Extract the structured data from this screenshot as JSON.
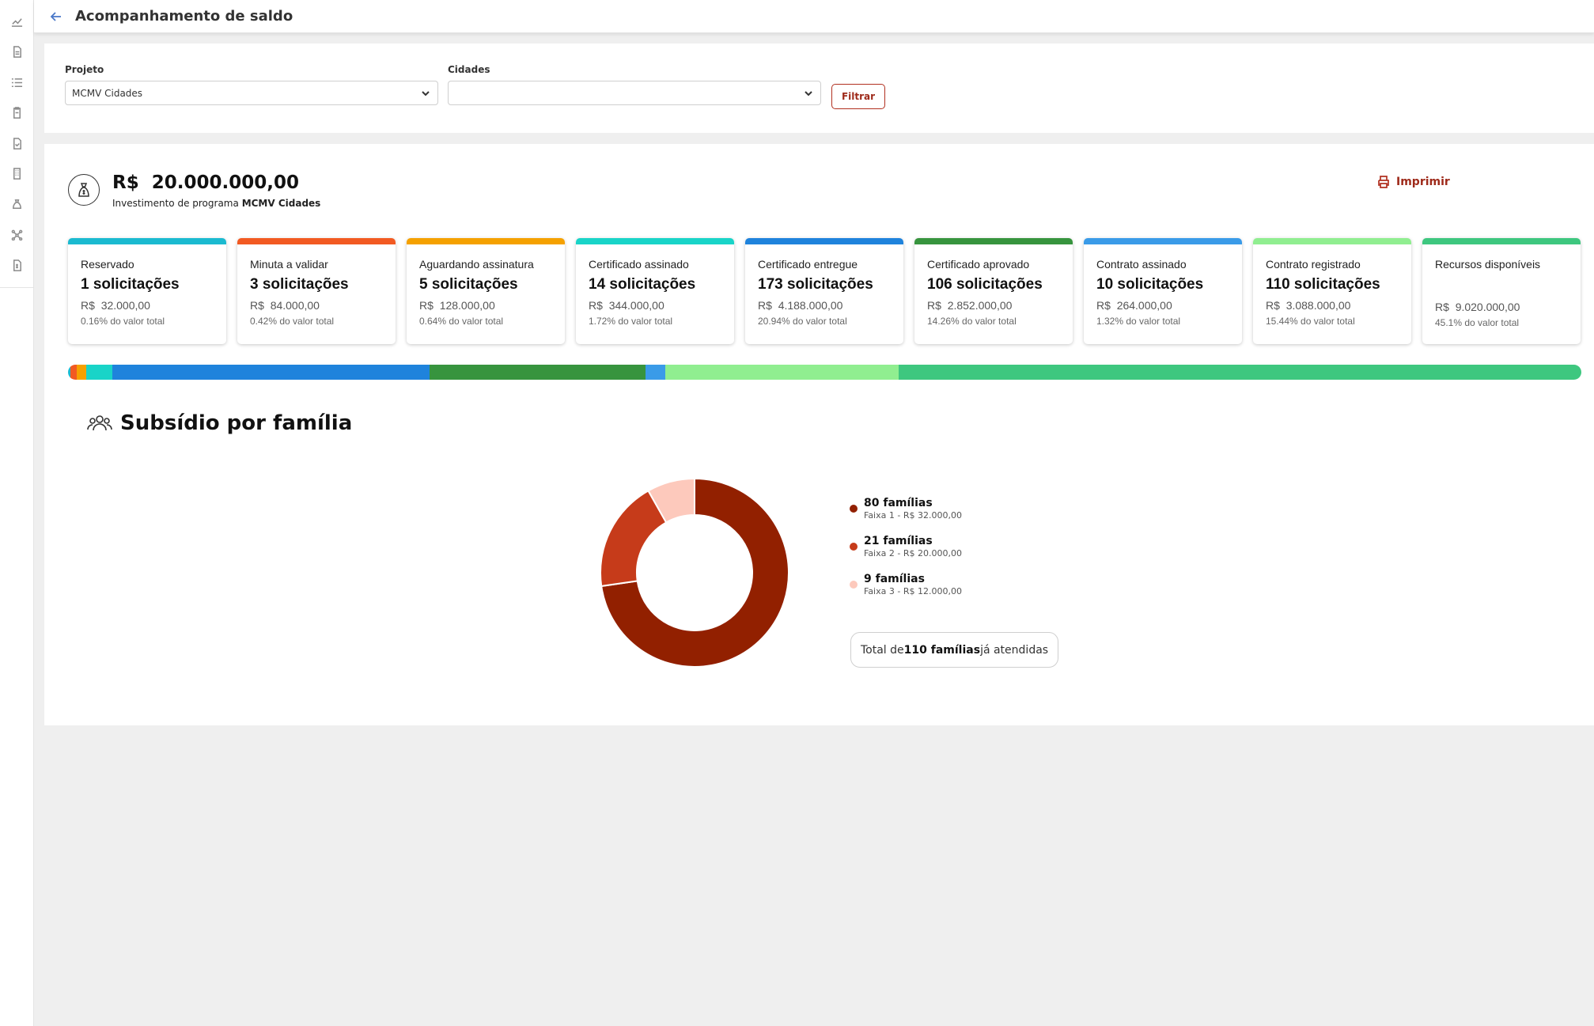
{
  "header": {
    "title": "Acompanhamento de saldo"
  },
  "sidebar": {
    "icons": [
      "chart-line-icon",
      "document-icon",
      "list-icon",
      "clipboard-icon",
      "file-check-icon",
      "building-icon",
      "money-bag-icon",
      "network-icon",
      "file-money-icon"
    ]
  },
  "filters": {
    "project_label": "Projeto",
    "project_value": "MCMV Cidades",
    "cities_label": "Cidades",
    "cities_value": "",
    "filter_button": "Filtrar"
  },
  "summary": {
    "currency": "R$",
    "total_value": "20.000.000,00",
    "investment_prefix": "Investimento de programa",
    "program_name": "MCMV Cidades",
    "print_label": "Imprimir"
  },
  "cards": [
    {
      "title": "Reservado",
      "count": "1 solicitações",
      "currency": "R$",
      "value": "32.000,00",
      "pct": "0.16% do valor total",
      "color": "#1bbad0"
    },
    {
      "title": "Minuta a validar",
      "count": "3 solicitações",
      "currency": "R$",
      "value": "84.000,00",
      "pct": "0.42% do valor total",
      "color": "#f25a22"
    },
    {
      "title": "Aguardando assinatura",
      "count": "5 solicitações",
      "currency": "R$",
      "value": "128.000,00",
      "pct": "0.64% do valor total",
      "color": "#f5a100"
    },
    {
      "title": "Certificado assinado",
      "count": "14 solicitações",
      "currency": "R$",
      "value": "344.000,00",
      "pct": "1.72% do valor total",
      "color": "#19d4c8"
    },
    {
      "title": "Certificado entregue",
      "count": "173 solicitações",
      "currency": "R$",
      "value": "4.188.000,00",
      "pct": "20.94% do valor total",
      "color": "#1f83dc"
    },
    {
      "title": "Certificado aprovado",
      "count": "106 solicitações",
      "currency": "R$",
      "value": "2.852.000,00",
      "pct": "14.26% do valor total",
      "color": "#37943e"
    },
    {
      "title": "Contrato assinado",
      "count": "10 solicitações",
      "currency": "R$",
      "value": "264.000,00",
      "pct": "1.32% do valor total",
      "color": "#3a9be8"
    },
    {
      "title": "Contrato registrado",
      "count": "110 solicitações",
      "currency": "R$",
      "value": "3.088.000,00",
      "pct": "15.44% do valor total",
      "color": "#90ee90"
    },
    {
      "title": "Recursos disponíveis",
      "count": "",
      "currency": "R$",
      "value": "9.020.000,00",
      "pct": "45.1% do valor total",
      "color": "#3ec77f"
    }
  ],
  "progress_shares": [
    0.16,
    0.42,
    0.64,
    1.72,
    20.94,
    14.26,
    1.32,
    15.44,
    45.1
  ],
  "families": {
    "section_title": "Subsídio por família",
    "items": [
      {
        "count": "80 famílias",
        "desc": "Faixa 1 - R$ 32.000,00",
        "value": 80,
        "color": "#922000"
      },
      {
        "count": "21 famílias",
        "desc": "Faixa 2 - R$ 20.000,00",
        "value": 21,
        "color": "#c63b1a"
      },
      {
        "count": "9 famílias",
        "desc": "Faixa 3 - R$ 12.000,00",
        "value": 9,
        "color": "#fdc9bc"
      }
    ],
    "total_prefix": "Total de",
    "total_strong": "110 famílias",
    "total_suffix": "já atendidas"
  },
  "chart_data": {
    "type": "pie",
    "categories": [
      "Faixa 1 - R$ 32.000,00",
      "Faixa 2 - R$ 20.000,00",
      "Faixa 3 - R$ 12.000,00"
    ],
    "values": [
      80,
      21,
      9
    ],
    "title": "Subsídio por família"
  }
}
